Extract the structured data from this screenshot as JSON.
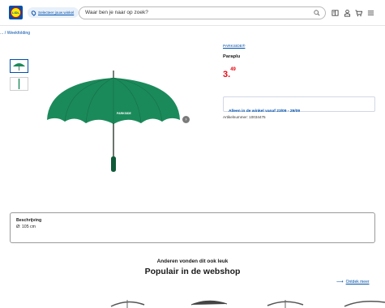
{
  "header": {
    "logo_text": "LIDL",
    "store_selector_label": "Selecteer jouw winkel",
    "search_placeholder": "Waar ben je naar op zoek?",
    "icons": [
      "search-icon",
      "folder-icon",
      "account-icon",
      "cart-icon",
      "menu-icon"
    ]
  },
  "breadcrumb": {
    "ellipsis": "...",
    "separator": "/",
    "current": "Weekfolding"
  },
  "product": {
    "brand": "PARKSIDE®",
    "name": "Paraplu",
    "price_main": "3.",
    "price_cents": "49",
    "availability": "Alleen in de winkel vanaf 23/09 - 29/09",
    "article_number": "Artikelnummer: 10034475",
    "umbrella_print": "PARKSIDE",
    "thumbnails": [
      "umbrella-open",
      "umbrella-closed"
    ]
  },
  "description": {
    "title": "Beschrijving",
    "body": "Ø: 105 cm"
  },
  "recommendations": {
    "subtitle": "Anderen vonden dit ook leuk",
    "title": "Populair in de webshop",
    "discover_label": "Ontdek meer"
  },
  "colors": {
    "brand_blue": "#0050aa",
    "price_red": "#e60a14",
    "umbrella_green": "#1b8a5a"
  }
}
